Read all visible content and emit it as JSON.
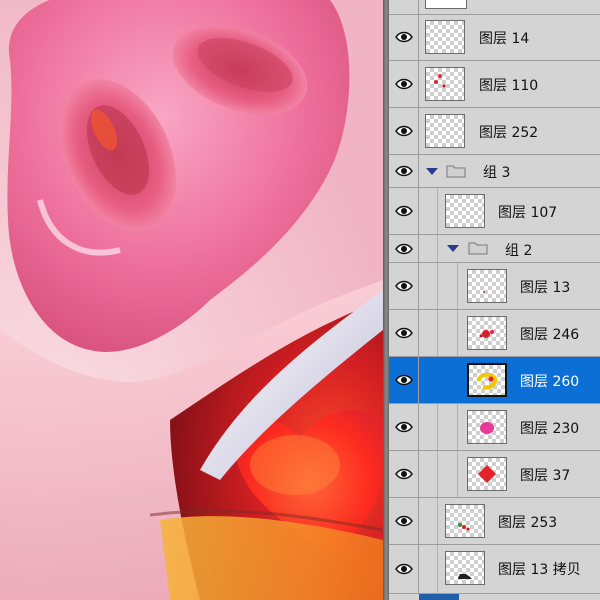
{
  "panel": {
    "layers": [
      {
        "id": "l14",
        "name": "图层 14",
        "selected": false,
        "thumb": "blank"
      },
      {
        "id": "l110",
        "name": "图层 110",
        "selected": false,
        "thumb": "red-specks"
      },
      {
        "id": "l252",
        "name": "图层 252",
        "selected": false,
        "thumb": "blank"
      },
      {
        "id": "g3",
        "name": "组 3",
        "group": true
      },
      {
        "id": "l107",
        "name": "图层 107",
        "selected": false,
        "thumb": "blank"
      },
      {
        "id": "g2",
        "name": "组 2",
        "group": true
      },
      {
        "id": "l13",
        "name": "图层 13",
        "selected": false,
        "thumb": "tiny-dot"
      },
      {
        "id": "l246",
        "name": "图层 246",
        "selected": false,
        "thumb": "red-shape"
      },
      {
        "id": "l260",
        "name": "图层 260",
        "selected": true,
        "thumb": "yellow-ring"
      },
      {
        "id": "l230",
        "name": "图层 230",
        "selected": false,
        "thumb": "pink-blob"
      },
      {
        "id": "l37",
        "name": "图层 37",
        "selected": false,
        "thumb": "red-diamond"
      },
      {
        "id": "l253",
        "name": "图层 253",
        "selected": false,
        "thumb": "green-red-specks"
      },
      {
        "id": "l13c",
        "name": "图层 13 拷贝",
        "selected": false,
        "thumb": "dark-shape"
      }
    ]
  },
  "colors": {
    "selection": "#0b6fd6",
    "panel_bg": "#d4d4d4",
    "snout_pink": "#f07aa2",
    "heart_red": "#e4242a"
  },
  "icons": {
    "visibility": "eye-icon",
    "group": "folder-icon",
    "expand": "triangle-down-icon"
  }
}
